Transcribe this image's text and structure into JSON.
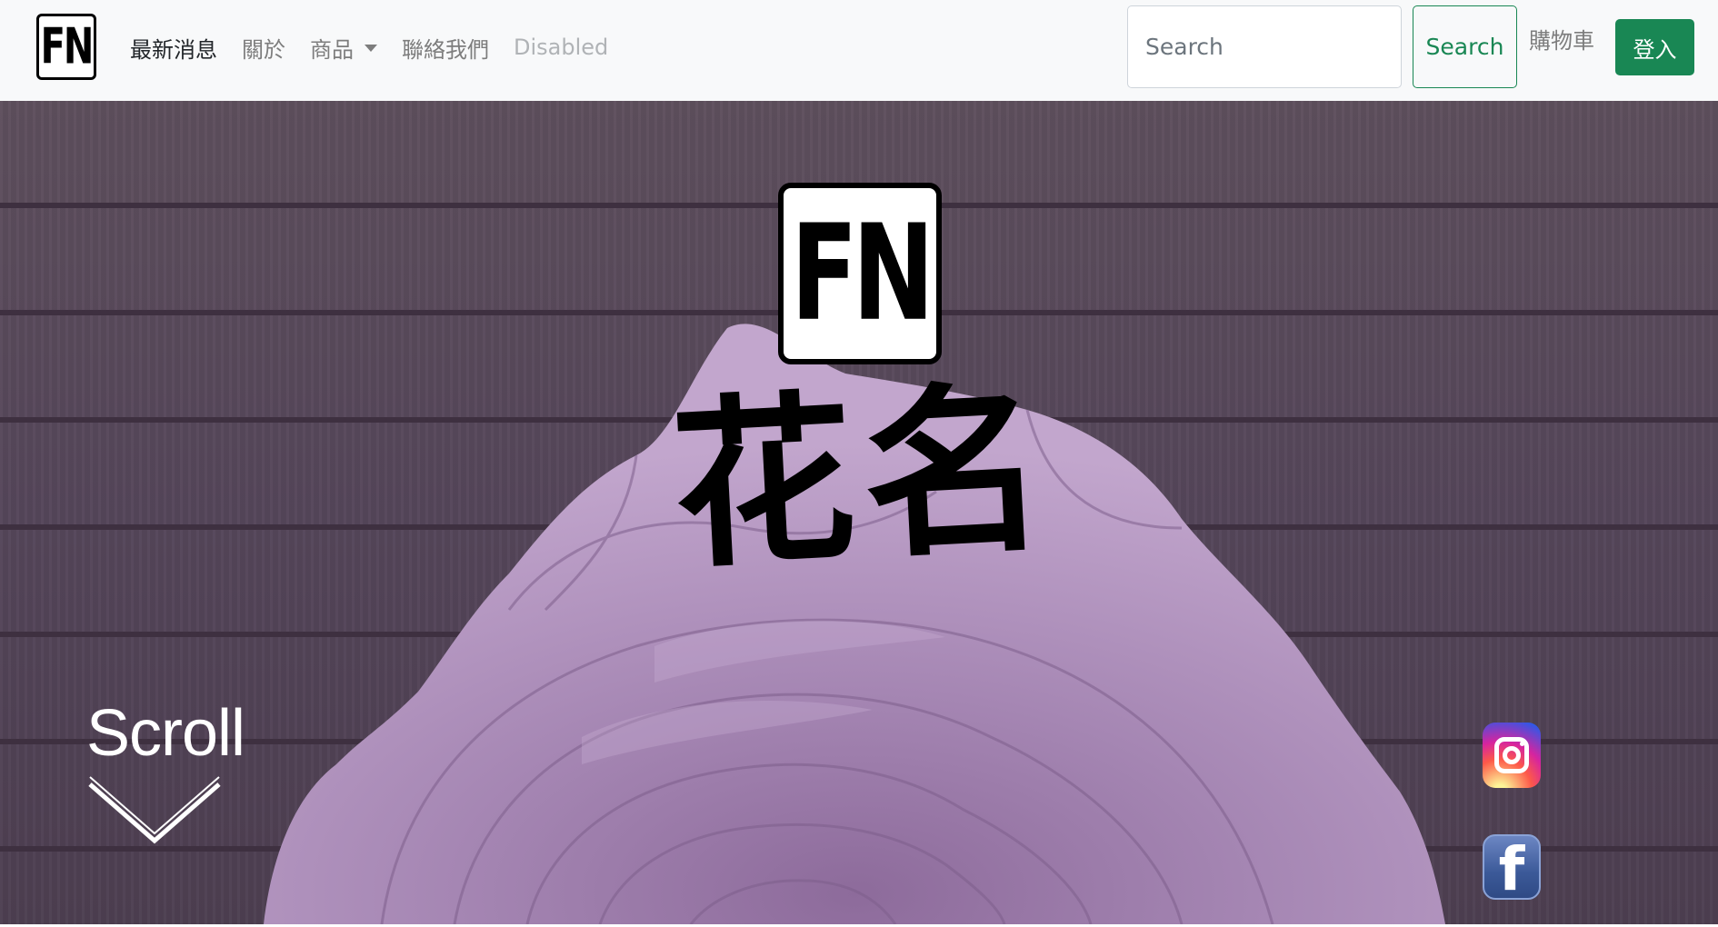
{
  "navbar": {
    "brand_text": "FN",
    "links": [
      {
        "label": "最新消息",
        "state": "active"
      },
      {
        "label": "關於",
        "state": "normal"
      },
      {
        "label": "商品",
        "state": "dropdown"
      },
      {
        "label": "聯絡我們",
        "state": "normal"
      },
      {
        "label": "Disabled",
        "state": "disabled"
      }
    ],
    "search": {
      "placeholder": "Search",
      "button_label": "Search"
    },
    "cart_label": "購物車",
    "login_label": "登入"
  },
  "hero": {
    "logo_text": "FN",
    "title": "花名",
    "scroll_label": "Scroll",
    "social": [
      {
        "name": "instagram-icon"
      },
      {
        "name": "facebook-icon"
      }
    ]
  },
  "colors": {
    "navbar_bg": "#f8f9fa",
    "success_green": "#198754",
    "hero_wood": "#55465a",
    "rose_purple": "#a98ab6"
  }
}
